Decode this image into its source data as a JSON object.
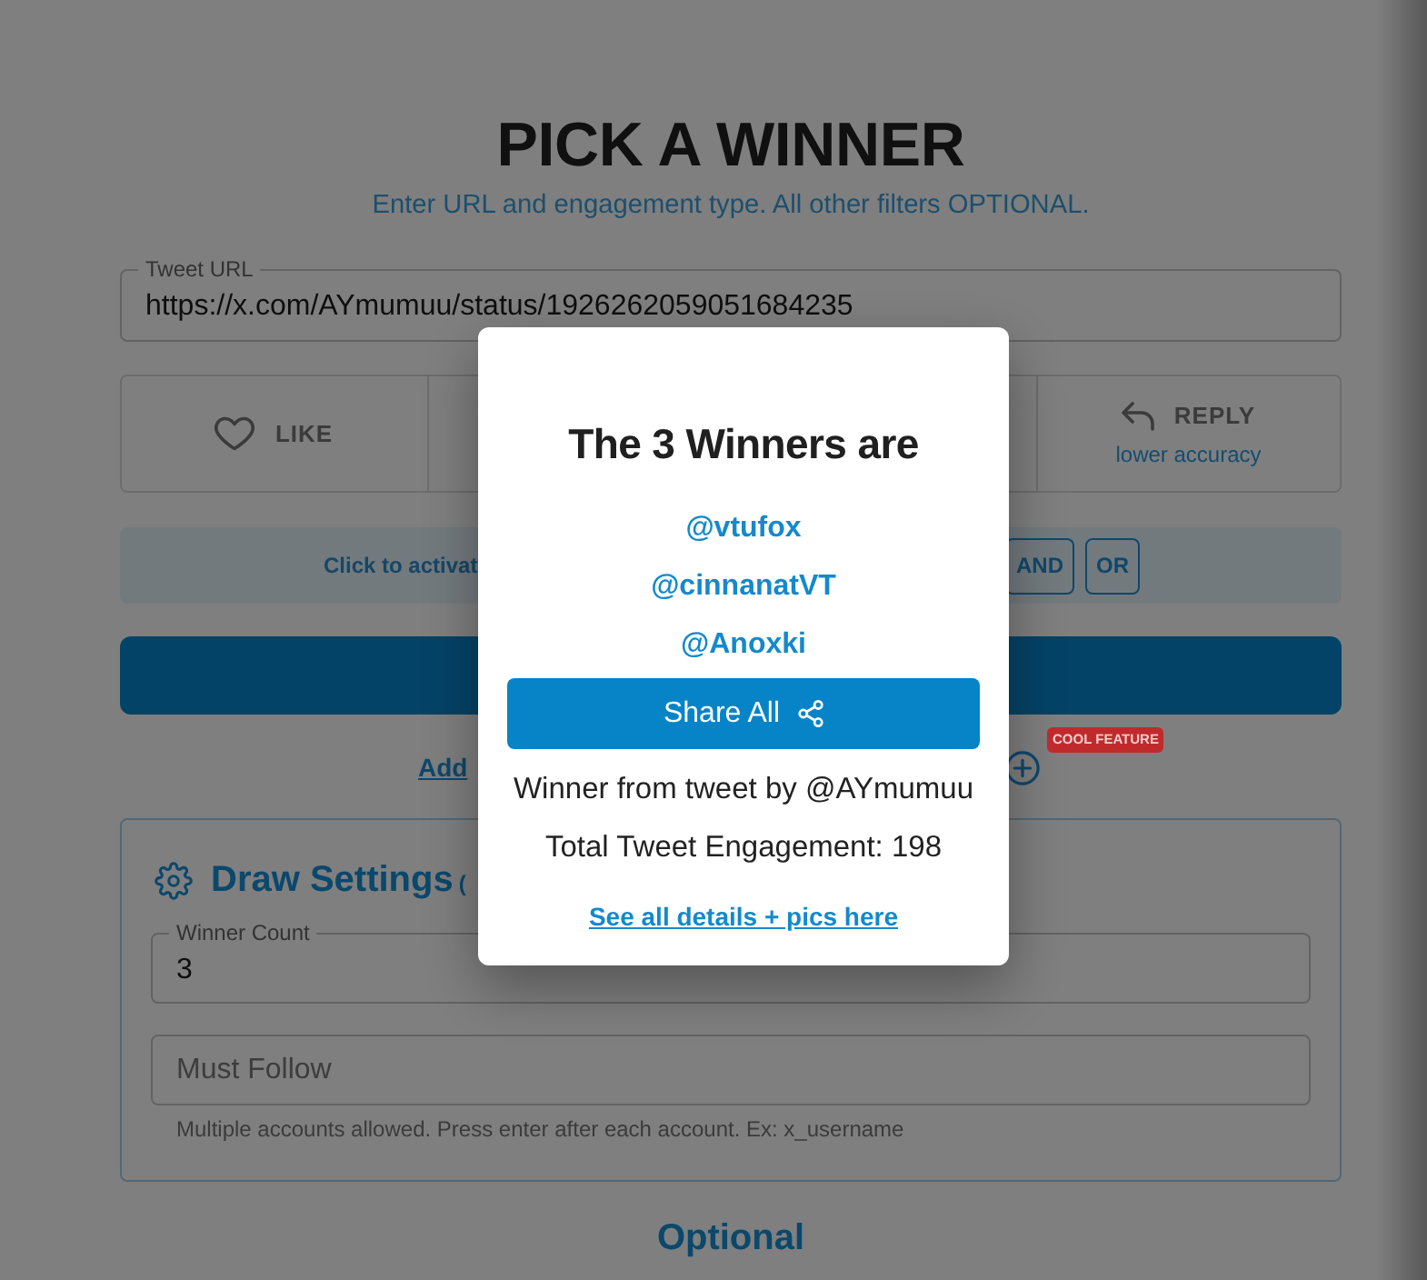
{
  "header": {
    "title": "PICK A WINNER",
    "subtitle": "Enter URL and engagement type. All other filters OPTIONAL."
  },
  "tweet_url": {
    "kind": "outlined",
    "label": "Tweet URL",
    "value": "https://x.com/AYmumuu/status/1926262059051684235"
  },
  "engagement_tabs": [
    {
      "kind": "like",
      "label": "LIKE",
      "selected": false
    },
    {
      "kind": "covered"
    },
    {
      "kind": "covered"
    },
    {
      "kind": "reply",
      "label": "REPLY",
      "note": "lower accuracy",
      "selected": false
    }
  ],
  "filter_bar": {
    "text": "Click to activat",
    "buttons": [
      "AND",
      "OR"
    ]
  },
  "add_row": {
    "link": "Add",
    "badge": "COOL FEATURE"
  },
  "draw_settings": {
    "title": "Draw Settings",
    "title_note": "(",
    "fields": [
      {
        "kind": "outlined",
        "label": "Winner Count",
        "value": "3"
      },
      {
        "kind": "plain",
        "placeholder": "Must Follow",
        "helper": "Multiple accounts allowed. Press enter after each account. Ex: x_username"
      }
    ]
  },
  "next_section": {
    "title": "Optional"
  },
  "winners_dialog": {
    "title": "The 3 Winners are",
    "winners": [
      "@vtufox",
      "@cinnanatVT",
      "@Anoxki"
    ],
    "share_button": "Share All",
    "author_line": "Winner from tweet by @AYmumuu",
    "engagement_line": "Total Tweet Engagement: 198",
    "details_link": "See all details + pics here"
  }
}
